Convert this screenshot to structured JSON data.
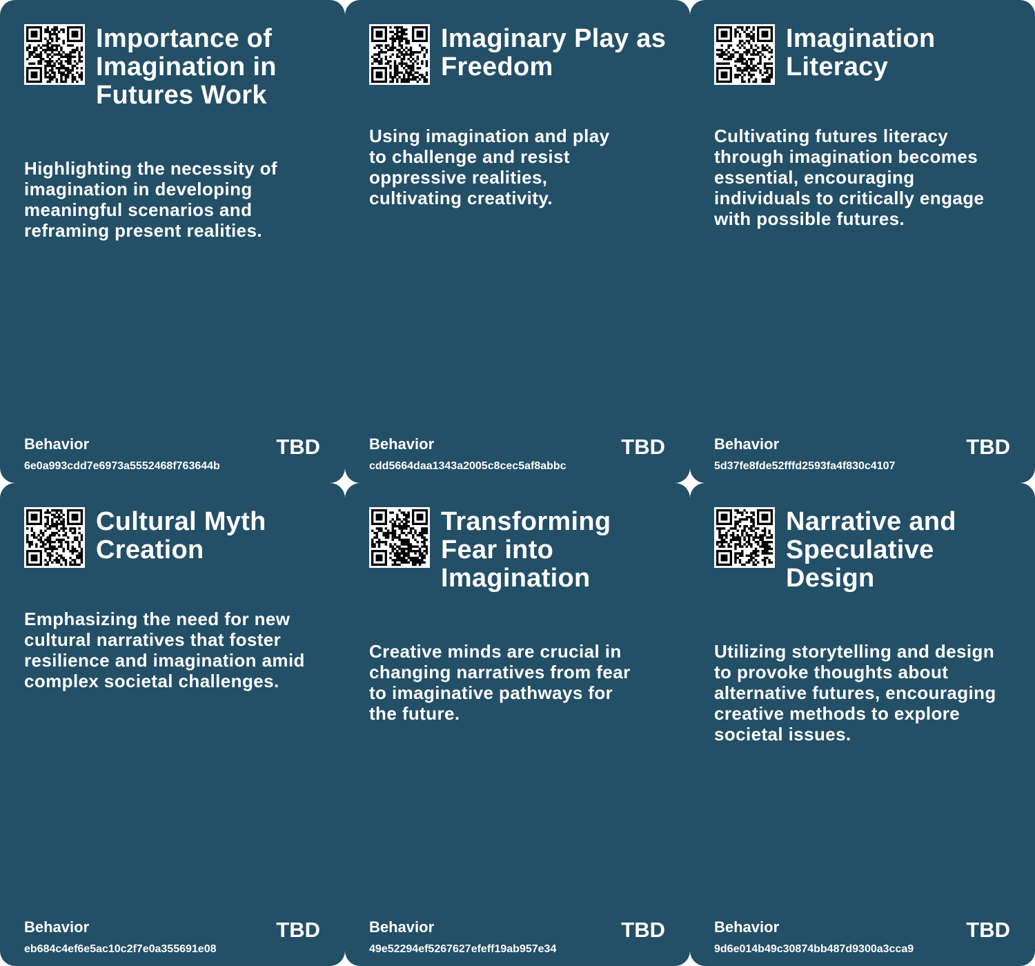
{
  "cards": [
    {
      "title": "Importance of Imagination in Futures Work",
      "description": "Highlighting the necessity of imagination in developing meaningful scenarios and reframing present realities.",
      "category": "Behavior",
      "status": "TBD",
      "id": "6e0a993cdd7e6973a5552468f763644b"
    },
    {
      "title": "Imaginary Play as Freedom",
      "description": "Using imagination and play to challenge and resist oppressive realities, cultivating creativity.",
      "category": "Behavior",
      "status": "TBD",
      "id": "cdd5664daa1343a2005c8cec5af8abbc"
    },
    {
      "title": "Imagination Literacy",
      "description": "Cultivating futures literacy through imagination becomes essential, encouraging individuals to critically engage with possible futures.",
      "category": "Behavior",
      "status": "TBD",
      "id": "5d37fe8fde52fffd2593fa4f830c4107"
    },
    {
      "title": "Cultural Myth Creation",
      "description": "Emphasizing the need for new cultural narratives that foster resilience and imagination amid complex societal challenges.",
      "category": "Behavior",
      "status": "TBD",
      "id": "eb684c4ef6e5ac10c2f7e0a355691e08"
    },
    {
      "title": "Transforming Fear into Imagination",
      "description": "Creative minds are crucial in changing narratives from fear to imaginative pathways for the future.",
      "category": "Behavior",
      "status": "TBD",
      "id": "49e52294ef5267627efeff19ab957e34"
    },
    {
      "title": "Narrative and Speculative Design",
      "description": "Utilizing storytelling and design to provoke thoughts about alternative futures, encouraging creative methods to explore societal issues.",
      "category": "Behavior",
      "status": "TBD",
      "id": "9d6e014b49c30874bb487d9300a3cca9"
    }
  ]
}
